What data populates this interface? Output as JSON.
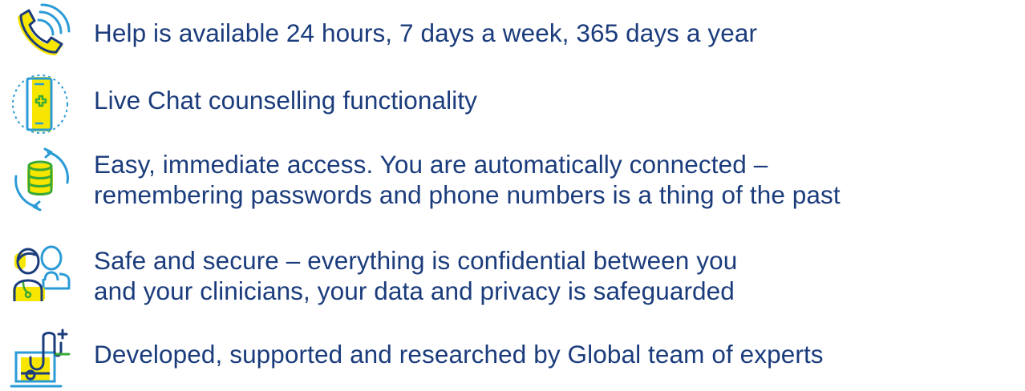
{
  "colors": {
    "text": "#1b3c7c",
    "accent_yellow": "#f7e600",
    "icon_outline": "#2b9bd6",
    "icon_dark": "#1b3c7c",
    "icon_green": "#3aa935"
  },
  "features": [
    {
      "icon": "phone-icon",
      "lines": [
        "Help is available 24 hours, 7 days a week, 365 days a year"
      ]
    },
    {
      "icon": "mobile-chat-icon",
      "lines": [
        "Live Chat counselling functionality"
      ]
    },
    {
      "icon": "database-sync-icon",
      "lines": [
        "Easy, immediate access. You are automatically connected –",
        "remembering passwords and phone numbers is a thing of the past"
      ]
    },
    {
      "icon": "users-icon",
      "lines": [
        "Safe and secure – everything is confidential between you",
        "and your clinicians, your data and privacy is safeguarded"
      ]
    },
    {
      "icon": "laptop-stethoscope-icon",
      "lines": [
        "Developed, supported and researched by Global team of experts"
      ]
    }
  ]
}
